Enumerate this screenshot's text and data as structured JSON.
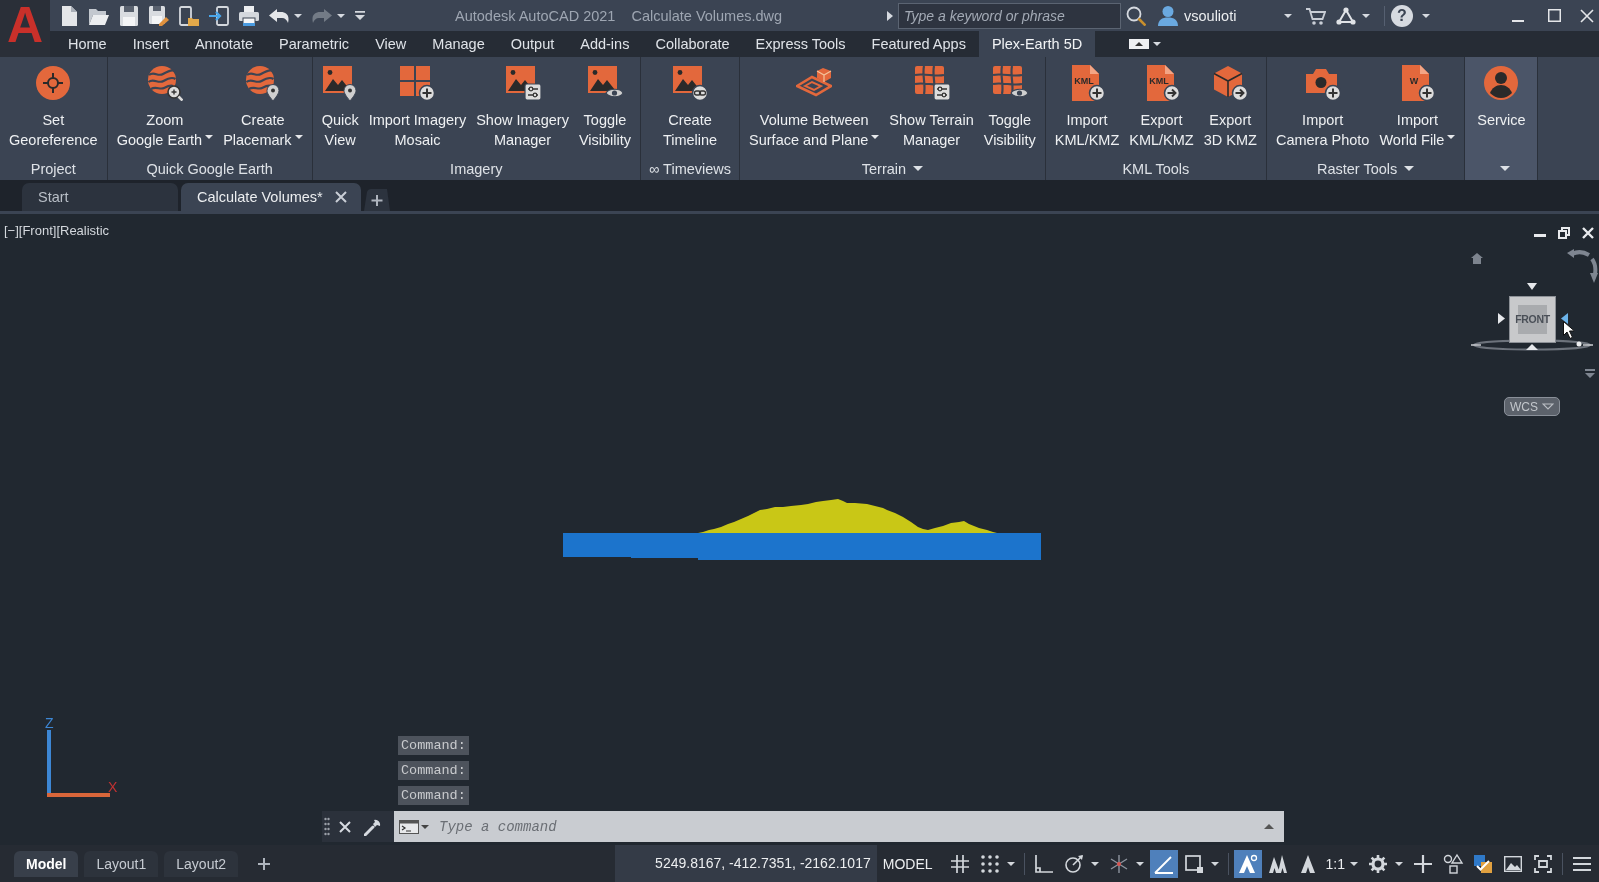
{
  "app": {
    "logo": "A"
  },
  "title_bar": {
    "app_name": "Autodesk AutoCAD 2021",
    "document": "Calculate Volumes.dwg",
    "search": {
      "placeholder": "Type a keyword or phrase"
    },
    "user": "vsoulioti",
    "help": "?"
  },
  "ribbon_tabs": [
    {
      "label": "Home",
      "selected": false
    },
    {
      "label": "Insert",
      "selected": false
    },
    {
      "label": "Annotate",
      "selected": false
    },
    {
      "label": "Parametric",
      "selected": false
    },
    {
      "label": "View",
      "selected": false
    },
    {
      "label": "Manage",
      "selected": false
    },
    {
      "label": "Output",
      "selected": false
    },
    {
      "label": "Add-ins",
      "selected": false
    },
    {
      "label": "Collaborate",
      "selected": false
    },
    {
      "label": "Express Tools",
      "selected": false
    },
    {
      "label": "Featured Apps",
      "selected": false
    },
    {
      "label": "Plex-Earth 5D",
      "selected": true
    }
  ],
  "ribbon_panels": [
    {
      "title": "Project",
      "title_menu": false,
      "highlighted": false,
      "buttons": [
        {
          "lines": [
            "Set",
            "Georeference"
          ],
          "dropdown": false
        }
      ]
    },
    {
      "title": "Quick Google Earth",
      "title_menu": false,
      "highlighted": false,
      "buttons": [
        {
          "lines": [
            "Zoom",
            "Google Earth"
          ],
          "dropdown": true
        },
        {
          "lines": [
            "Create",
            "Placemark"
          ],
          "dropdown": true
        }
      ]
    },
    {
      "title": "Imagery",
      "title_menu": false,
      "highlighted": false,
      "buttons": [
        {
          "lines": [
            "Quick",
            "View"
          ],
          "dropdown": false
        },
        {
          "lines": [
            "Import Imagery",
            "Mosaic"
          ],
          "dropdown": false
        },
        {
          "lines": [
            "Show Imagery",
            "Manager"
          ],
          "dropdown": false
        },
        {
          "lines": [
            "Toggle",
            "Visibility"
          ],
          "dropdown": false
        }
      ]
    },
    {
      "title": "∞ Timeviews",
      "title_menu": false,
      "highlighted": false,
      "buttons": [
        {
          "lines": [
            "Create",
            "Timeline"
          ],
          "dropdown": false
        }
      ]
    },
    {
      "title": "Terrain",
      "title_menu": true,
      "highlighted": false,
      "buttons": [
        {
          "lines": [
            "Volume Between",
            "Surface and Plane"
          ],
          "dropdown": true
        },
        {
          "lines": [
            "Show Terrain",
            "Manager"
          ],
          "dropdown": false
        },
        {
          "lines": [
            "Toggle",
            "Visibility"
          ],
          "dropdown": false
        }
      ]
    },
    {
      "title": "KML Tools",
      "title_menu": false,
      "highlighted": false,
      "buttons": [
        {
          "lines": [
            "Import",
            "KML/KMZ"
          ],
          "dropdown": false,
          "icon_text": "KML"
        },
        {
          "lines": [
            "Export",
            "KML/KMZ"
          ],
          "dropdown": false,
          "icon_text": "KML"
        },
        {
          "lines": [
            "Export",
            "3D KMZ"
          ],
          "dropdown": false
        }
      ]
    },
    {
      "title": "Raster Tools",
      "title_menu": true,
      "highlighted": false,
      "buttons": [
        {
          "lines": [
            "Import",
            "Camera Photo"
          ],
          "dropdown": false
        },
        {
          "lines": [
            "Import",
            "World File"
          ],
          "dropdown": true,
          "icon_text": "W"
        }
      ]
    },
    {
      "title_menu": true,
      "highlighted": true,
      "buttons": [
        {
          "lines": [
            "Service"
          ],
          "dropdown": false
        }
      ]
    }
  ],
  "document_tabs": [
    {
      "label": "Start",
      "selected": false,
      "closable": false
    },
    {
      "label": "Calculate Volumes*",
      "selected": true,
      "closable": true
    }
  ],
  "viewport": {
    "label": "[−][Front][Realistic",
    "viewcube": {
      "face": "FRONT",
      "coordinate_system": "WCS"
    },
    "ucs_labels": [
      "Z",
      "X"
    ]
  },
  "command_line": {
    "history": [
      "Command:",
      "Command:",
      "Command:"
    ],
    "placeholder": "Type a command"
  },
  "layout_tabs": [
    {
      "label": "Model",
      "selected": true
    },
    {
      "label": "Layout1",
      "selected": false
    },
    {
      "label": "Layout2",
      "selected": false
    }
  ],
  "status_bar": {
    "coordinates": "5249.8167, -412.7351, -2162.1017",
    "space": "MODEL",
    "tools": [
      {
        "kind": "icon",
        "on": false,
        "dropdown": false
      },
      {
        "kind": "icon",
        "on": false,
        "dropdown": true
      },
      {
        "kind": "icon",
        "on": false,
        "dropdown": false
      },
      {
        "kind": "icon",
        "on": false,
        "dropdown": true
      },
      {
        "kind": "icon",
        "on": false,
        "dropdown": true
      },
      {
        "kind": "icon",
        "on": true,
        "dropdown": false
      },
      {
        "kind": "icon",
        "on": false,
        "dropdown": true
      },
      {
        "kind": "icon",
        "on": true,
        "dropdown": false
      },
      {
        "kind": "icon",
        "on": false,
        "dropdown": false
      },
      {
        "kind": "icon",
        "on": false,
        "dropdown": false
      },
      {
        "kind": "text",
        "label": "1:1",
        "on": false,
        "dropdown": true
      },
      {
        "kind": "icon",
        "on": false,
        "dropdown": true
      },
      {
        "kind": "icon",
        "on": false,
        "dropdown": false
      },
      {
        "kind": "icon",
        "on": false,
        "dropdown": false
      },
      {
        "kind": "icon",
        "on": false,
        "dropdown": false
      },
      {
        "kind": "icon",
        "on": false,
        "dropdown": false
      },
      {
        "kind": "icon",
        "on": false,
        "dropdown": false
      },
      {
        "kind": "icon",
        "on": false,
        "dropdown": false
      }
    ]
  }
}
